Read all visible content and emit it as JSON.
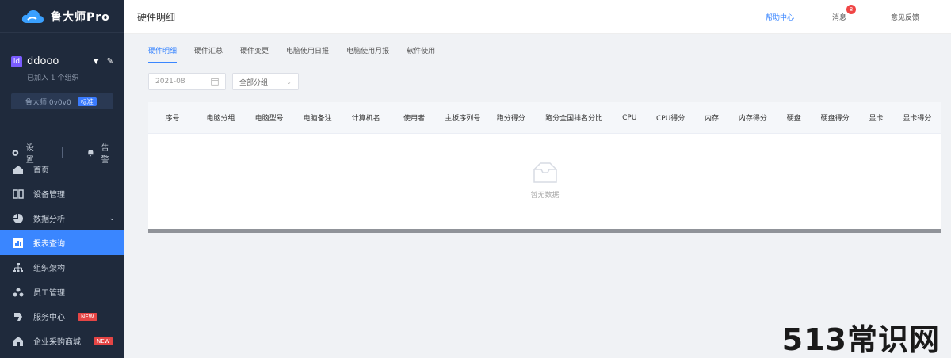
{
  "app": {
    "name": "鲁大师Pro"
  },
  "user": {
    "name": "ddooo",
    "avatar": "ld",
    "sub": "已加入 1 个组织",
    "company": "鲁大师 0v0v0",
    "company_tag": "标准"
  },
  "quick": {
    "settings": "设置",
    "alarm": "告警"
  },
  "menu": [
    {
      "label": "首页",
      "icon": "home-icon"
    },
    {
      "label": "设备管理",
      "icon": "device-icon"
    },
    {
      "label": "数据分析",
      "icon": "pie-chart-icon",
      "arrow": "⌄"
    },
    {
      "label": "报表查询",
      "icon": "report-icon",
      "active": true
    },
    {
      "label": "组织架构",
      "icon": "org-icon"
    },
    {
      "label": "员工管理",
      "icon": "staff-icon"
    },
    {
      "label": "服务中心",
      "icon": "service-icon",
      "badge": "NEW"
    },
    {
      "label": "企业采购商城",
      "icon": "shop-icon",
      "badge": "NEW"
    }
  ],
  "header": {
    "title": "硬件明细",
    "link": "帮助中心",
    "message": "消息",
    "message_count": "8",
    "help": "意见反馈"
  },
  "tabs": [
    {
      "label": "硬件明细",
      "active": true
    },
    {
      "label": "硬件汇总"
    },
    {
      "label": "硬件变更"
    },
    {
      "label": "电脑使用日报"
    },
    {
      "label": "电脑使用月报"
    },
    {
      "label": "软件使用"
    }
  ],
  "filters": {
    "date": "2021-08",
    "group": "全部分组"
  },
  "table": {
    "columns": [
      "序号",
      "电脑分组",
      "电脑型号",
      "电脑备注",
      "计算机名",
      "使用者",
      "主板序列号",
      "跑分得分",
      "跑分全国排名分比",
      "CPU",
      "CPU得分",
      "内存",
      "内存得分",
      "硬盘",
      "硬盘得分",
      "显卡",
      "显卡得分"
    ],
    "empty": "暂无数据"
  },
  "watermark": "513常识网"
}
